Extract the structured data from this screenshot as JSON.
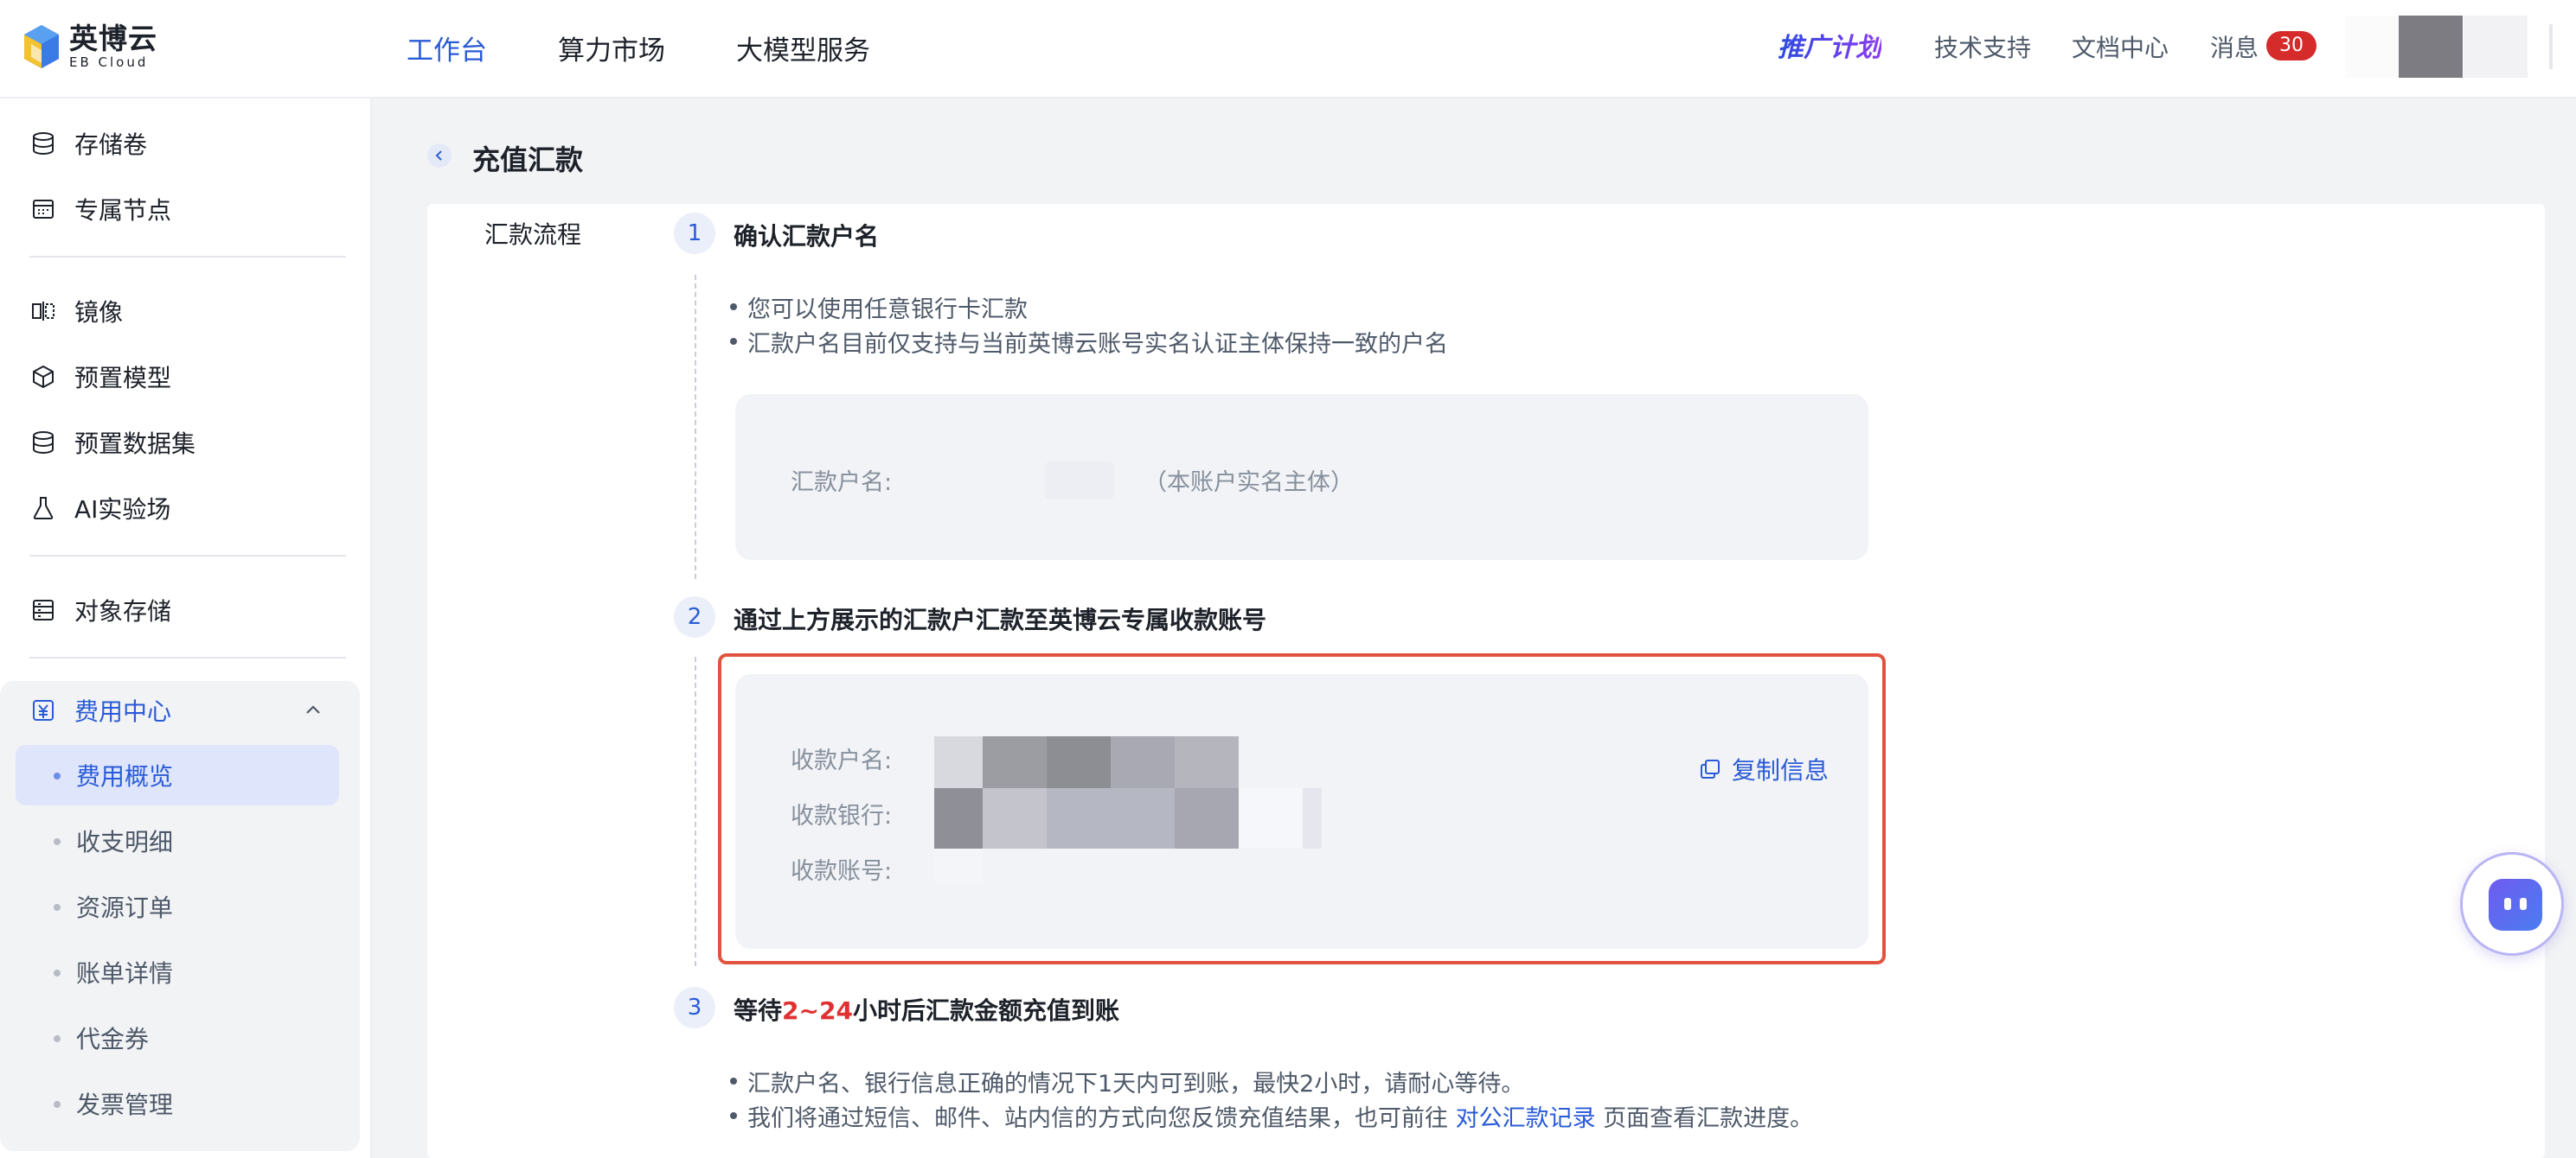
{
  "brand": {
    "name_cn": "英博云",
    "name_en": "EB Cloud"
  },
  "nav": {
    "items": [
      "工作台",
      "算力市场",
      "大模型服务"
    ],
    "active_index": 0
  },
  "top_right": {
    "promo": "推广计划",
    "support": "技术支持",
    "docs": "文档中心",
    "messages": "消息",
    "message_count": "30"
  },
  "sidebar": {
    "items": [
      "存储卷",
      "专属节点",
      "镜像",
      "预置模型",
      "预置数据集",
      "AI实验场",
      "对象存储"
    ],
    "fee_center": {
      "label": "费用中心",
      "sub_items": [
        "费用概览",
        "收支明细",
        "资源订单",
        "账单详情",
        "代金券",
        "发票管理"
      ],
      "active_index": 0
    }
  },
  "page": {
    "title": "充值汇款",
    "flow_label": "汇款流程",
    "steps": [
      {
        "num": "1",
        "title": "确认汇款户名",
        "bullets": [
          "您可以使用任意银行卡汇款",
          "汇款户名目前仅支持与当前英博云账号实名认证主体保持一致的户名"
        ],
        "card_label": "汇款户名:",
        "card_note": "（本账户实名主体）"
      },
      {
        "num": "2",
        "title": "通过上方展示的汇款户汇款至英博云专属收款账号",
        "labels": [
          "收款户名:",
          "收款银行:",
          "收款账号:"
        ],
        "copy_label": "复制信息"
      },
      {
        "num": "3",
        "title_prefix": "等待",
        "title_highlight": "2~24",
        "title_suffix": "小时后汇款金额充值到账",
        "bullets": [
          "汇款户名、银行信息正确的情况下1天内可到账，最快2小时，请耐心等待。"
        ],
        "bullet2_prefix": "我们将通过短信、邮件、站内信的方式向您反馈充值结果，也可前往",
        "bullet2_link": "对公汇款记录",
        "bullet2_suffix": "页面查看汇款进度。"
      }
    ]
  },
  "colors": {
    "accent": "#2a5bd7",
    "highlight": "#e03131",
    "frame": "#e2533f"
  },
  "icons": [
    "database-icon",
    "node-icon",
    "mirror-icon",
    "cube-icon",
    "dataset-icon",
    "flask-icon",
    "storage-icon",
    "yuan-icon",
    "chevron-up-icon",
    "chevron-left-icon",
    "copy-icon",
    "bot-icon"
  ]
}
